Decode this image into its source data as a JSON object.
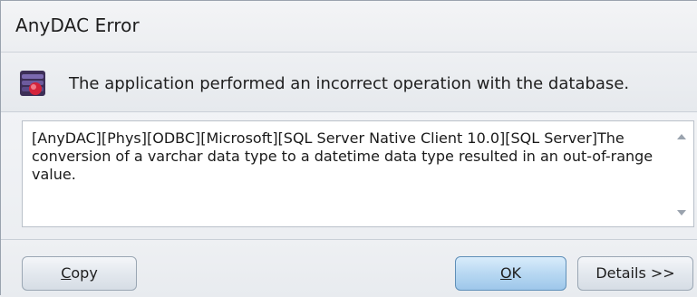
{
  "window": {
    "title": "AnyDAC Error"
  },
  "header": {
    "icon": "database-error-icon",
    "message": "The application performed an incorrect operation with the database."
  },
  "detail": {
    "text": "[AnyDAC][Phys][ODBC][Microsoft][SQL Server Native Client 10.0][SQL Server]The conversion of a varchar data type to a datetime data type resulted in an out-of-range value."
  },
  "buttons": {
    "copy_label": "Copy",
    "ok_label": "OK",
    "details_label": "Details >>"
  },
  "colors": {
    "ok_accent": "#b8d8f2",
    "icon_red": "#d4233a",
    "icon_purple": "#5a3f7a"
  }
}
